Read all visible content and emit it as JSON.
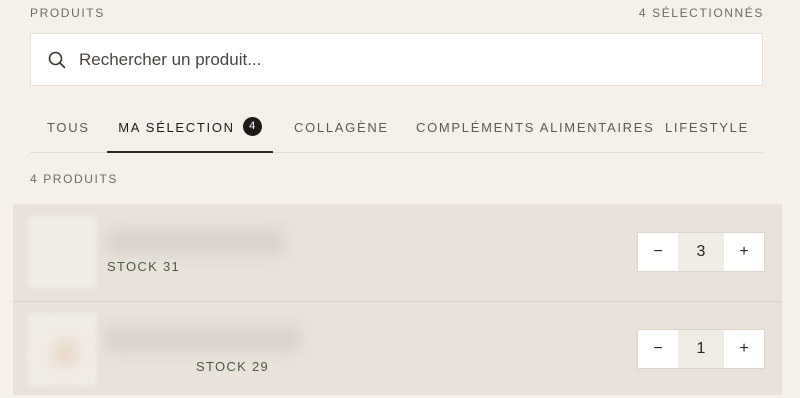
{
  "header": {
    "title": "PRODUITS",
    "selected_count": "4 SÉLECTIONNÉS"
  },
  "search": {
    "placeholder": "Rechercher un produit...",
    "value": "",
    "icon": "search-icon"
  },
  "tabs": [
    {
      "label": "TOUS",
      "active": false
    },
    {
      "label": "MA SÉLECTION",
      "active": true,
      "badge": "4"
    },
    {
      "label": "COLLAGÈNE",
      "active": false
    },
    {
      "label": "COMPLÉMENTS ALIMENTAIRES",
      "active": false
    },
    {
      "label": "LIFESTYLE",
      "active": false
    }
  ],
  "products_count": "4 PRODUITS",
  "products": [
    {
      "name_hidden": true,
      "stock": "STOCK 31",
      "quantity": "3",
      "minus": "−",
      "plus": "+"
    },
    {
      "name_hidden": true,
      "stock": "STOCK 29",
      "quantity": "1",
      "minus": "−",
      "plus": "+"
    }
  ],
  "colors": {
    "background": "#f5f0ea",
    "list_bg": "#e8e2da",
    "stock_text": "#4c5a45",
    "badge": "#1e1a17"
  }
}
